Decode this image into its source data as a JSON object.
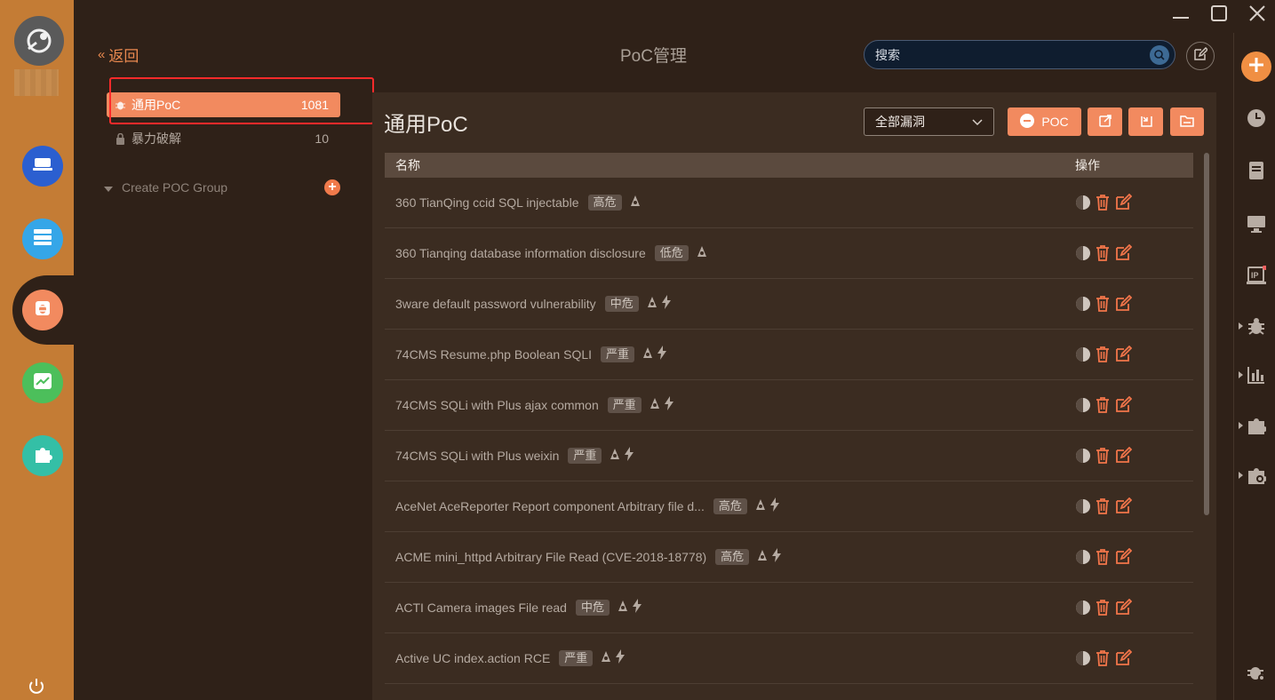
{
  "header": {
    "back_label": "返回",
    "page_title": "PoC管理",
    "search_placeholder": "搜索"
  },
  "groups": [
    {
      "label": "通用PoC",
      "count": "1081",
      "icon": "bug-icon",
      "active": true
    },
    {
      "label": "暴力破解",
      "count": "10",
      "icon": "lock-icon",
      "active": false
    }
  ],
  "create_group_label": "Create POC Group",
  "main": {
    "title": "通用PoC",
    "filter_value": "全部漏洞",
    "add_poc_label": "POC",
    "columns": {
      "name": "名称",
      "ops": "操作"
    },
    "rows": [
      {
        "name": "360 TianQing ccid SQL injectable",
        "severity": "高危",
        "bolt": false
      },
      {
        "name": "360 Tianqing database information disclosure",
        "severity": "低危",
        "bolt": false
      },
      {
        "name": "3ware default password vulnerability",
        "severity": "中危",
        "bolt": true
      },
      {
        "name": "74CMS Resume.php Boolean SQLI",
        "severity": "严重",
        "bolt": true
      },
      {
        "name": "74CMS SQLi with Plus ajax common",
        "severity": "严重",
        "bolt": true
      },
      {
        "name": "74CMS SQLi with Plus weixin",
        "severity": "严重",
        "bolt": true
      },
      {
        "name": "AceNet AceReporter Report component Arbitrary file d...",
        "severity": "高危",
        "bolt": true
      },
      {
        "name": "ACME mini_httpd Arbitrary File Read (CVE-2018-18778)",
        "severity": "高危",
        "bolt": true
      },
      {
        "name": "ACTI Camera images File read",
        "severity": "中危",
        "bolt": true
      },
      {
        "name": "Active UC index.action RCE",
        "severity": "严重",
        "bolt": true
      }
    ]
  },
  "colors": {
    "accent": "#f28a5f",
    "rail": "#c47c35",
    "background": "#2f2118",
    "panel": "#3b2c21"
  }
}
